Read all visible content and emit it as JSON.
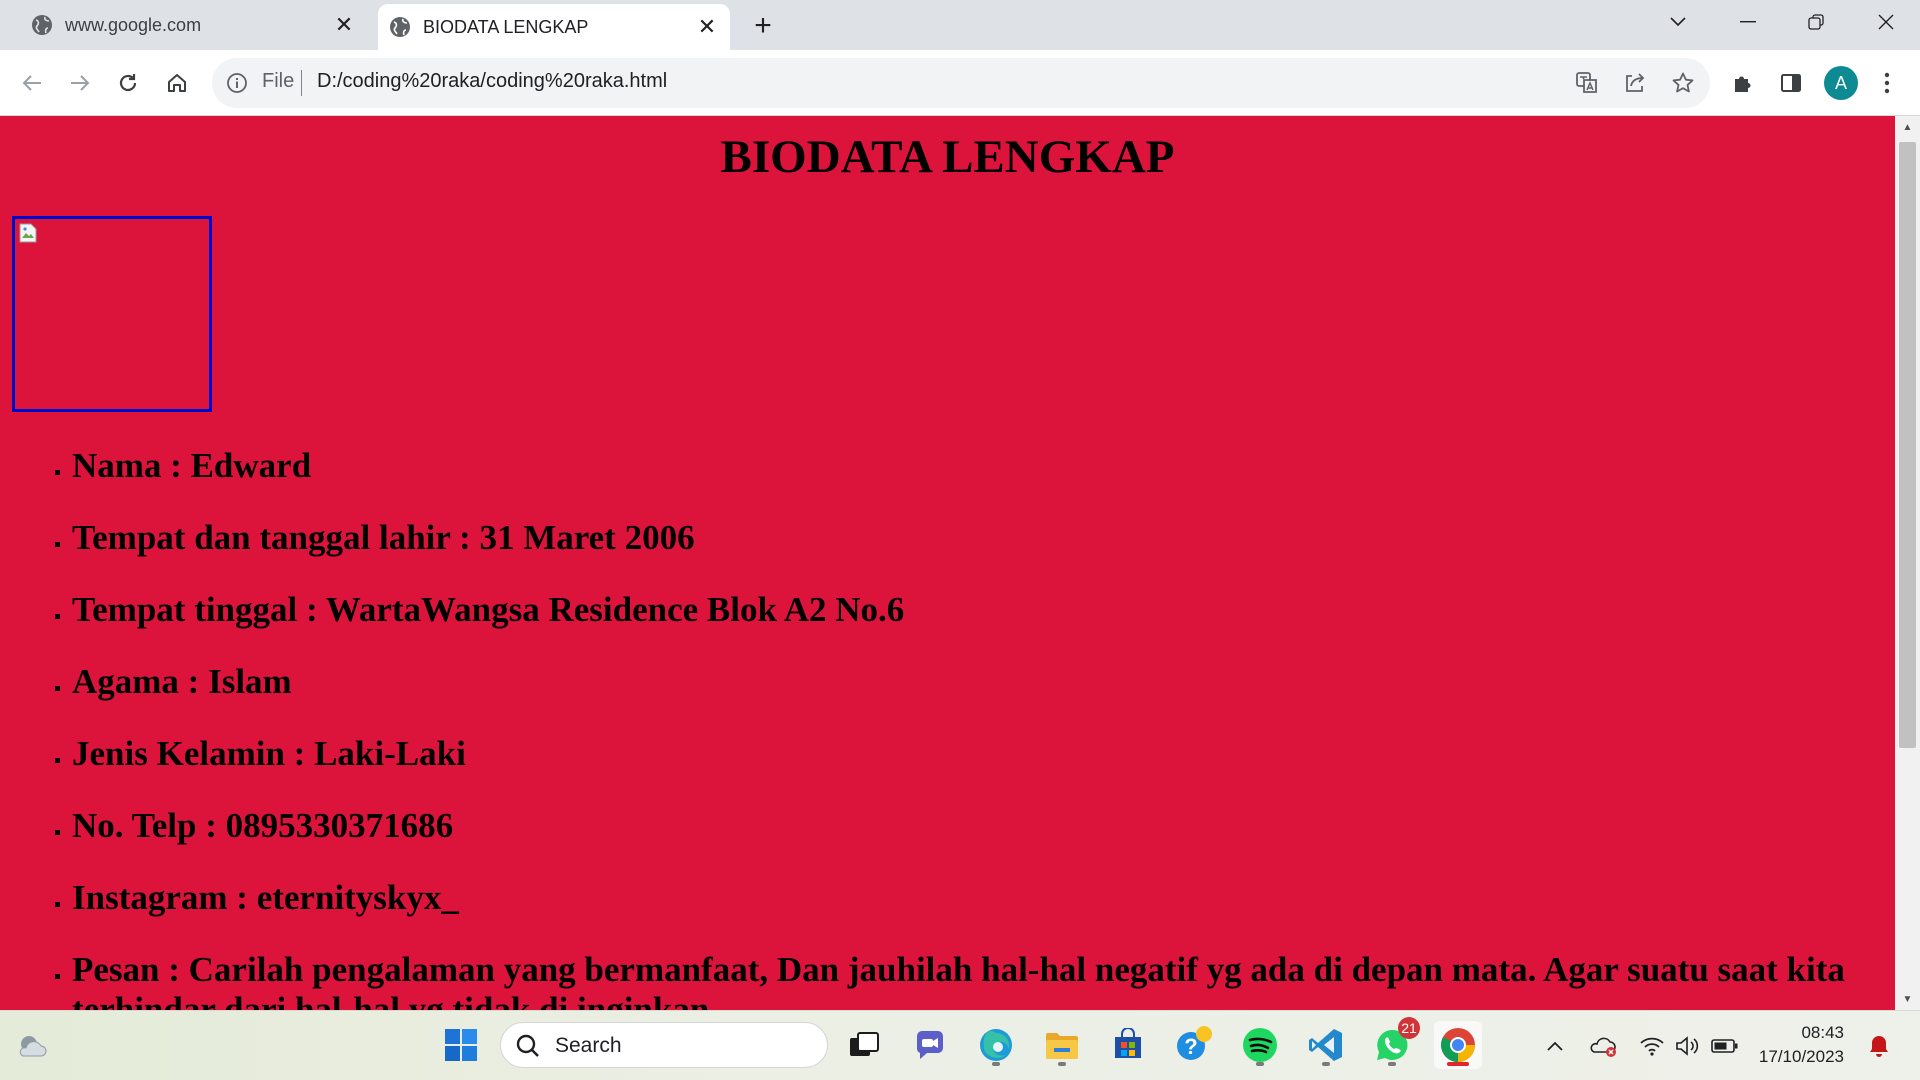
{
  "browser": {
    "tabs": [
      {
        "title": "www.google.com",
        "active": false
      },
      {
        "title": "BIODATA LENGKAP",
        "active": true
      }
    ],
    "address": {
      "scheme": "File",
      "url": "D:/coding%20raka/coding%20raka.html"
    },
    "profile_initial": "A"
  },
  "page": {
    "heading": "BIODATA LENGKAP",
    "items": [
      "Nama : Edward",
      "Tempat dan tanggal lahir : 31 Maret 2006",
      "Tempat tinggal : WartaWangsa Residence Blok A2 No.6",
      "Agama : Islam",
      "Jenis Kelamin : Laki-Laki",
      "No. Telp : 0895330371686",
      "Instagram : eternityskyx_",
      "Pesan : Carilah pengalaman yang bermanfaat, Dan jauhilah hal-hal negatif yg ada di depan mata. Agar suatu saat kita terhindar dari hal-hal yg tidak di inginkan"
    ],
    "background_color": "#dc143c"
  },
  "taskbar": {
    "search_label": "Search",
    "whatsapp_badge": "21",
    "time": "08:43",
    "date": "17/10/2023"
  }
}
